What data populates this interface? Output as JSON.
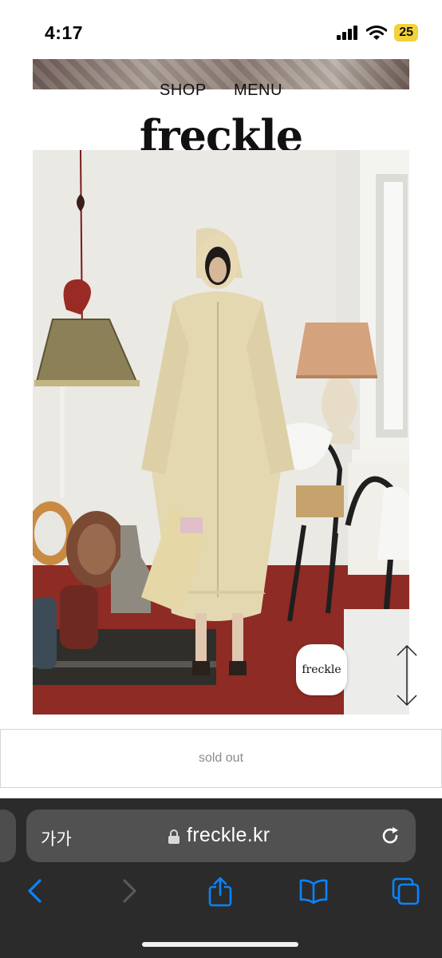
{
  "status_bar": {
    "time": "4:17",
    "battery_level": "25",
    "battery_color": "#f2d23a"
  },
  "site_nav": {
    "shop_label": "SHOP",
    "menu_label": "MENU"
  },
  "site_logo": "freckle",
  "product": {
    "badge_text": "freckle",
    "status_label": "sold out"
  },
  "browser": {
    "text_size_button": "가가",
    "url": "freckle.kr",
    "icons": [
      "lock-icon",
      "reload-icon",
      "back-icon",
      "forward-icon",
      "share-icon",
      "bookmarks-icon",
      "tabs-icon"
    ],
    "accent_color": "#0a84ff"
  }
}
